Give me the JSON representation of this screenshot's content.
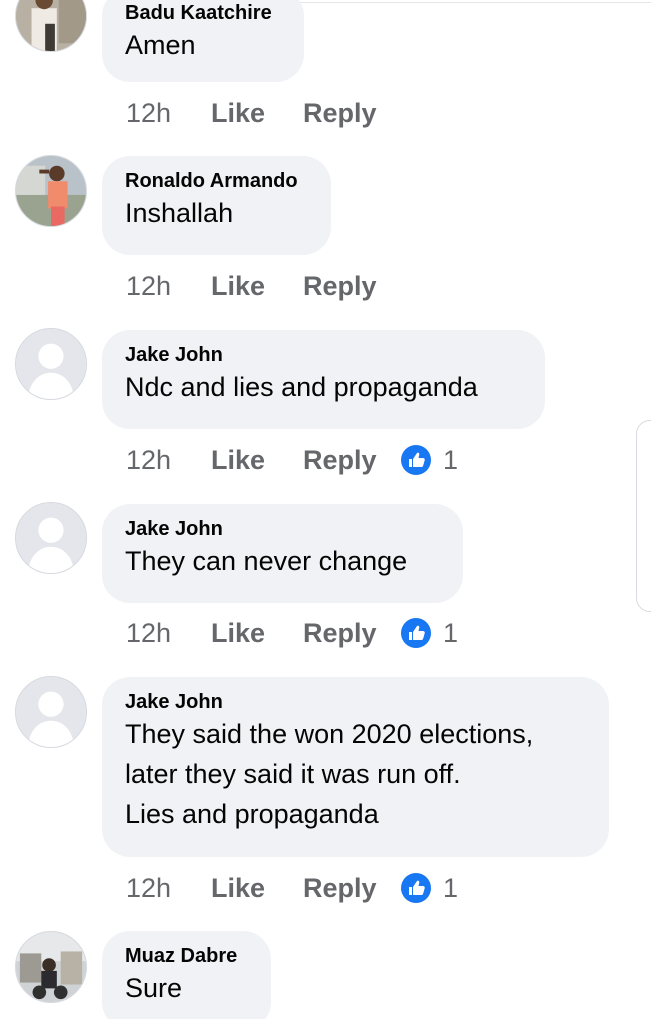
{
  "comments": [
    {
      "author": "Badu Kaatchire",
      "text_lines": [
        "Amen"
      ],
      "time": "12h",
      "like_label": "Like",
      "reply_label": "Reply",
      "reaction_count": null
    },
    {
      "author": "Ronaldo Armando",
      "text_lines": [
        "Inshallah"
      ],
      "time": "12h",
      "like_label": "Like",
      "reply_label": "Reply",
      "reaction_count": null
    },
    {
      "author": "Jake John",
      "text_lines": [
        "Ndc and lies and propaganda"
      ],
      "time": "12h",
      "like_label": "Like",
      "reply_label": "Reply",
      "reaction_count": "1"
    },
    {
      "author": "Jake John",
      "text_lines": [
        "They can never change"
      ],
      "time": "12h",
      "like_label": "Like",
      "reply_label": "Reply",
      "reaction_count": "1"
    },
    {
      "author": "Jake John",
      "text_lines": [
        "They said the won 2020 elections,",
        "later they said it was run off.",
        "Lies and propaganda"
      ],
      "time": "12h",
      "like_label": "Like",
      "reply_label": "Reply",
      "reaction_count": "1"
    },
    {
      "author": "Muaz Dabre",
      "text_lines": [
        "Sure"
      ],
      "time": null,
      "like_label": null,
      "reply_label": null,
      "reaction_count": null
    }
  ],
  "colors": {
    "bubble": "#f0f2f5",
    "secondary_text": "#65676b",
    "like_blue": "#1877f2"
  },
  "icons": {
    "reaction": "thumbs-up-like-icon",
    "avatar_placeholder": "default-profile-silhouette-icon"
  }
}
